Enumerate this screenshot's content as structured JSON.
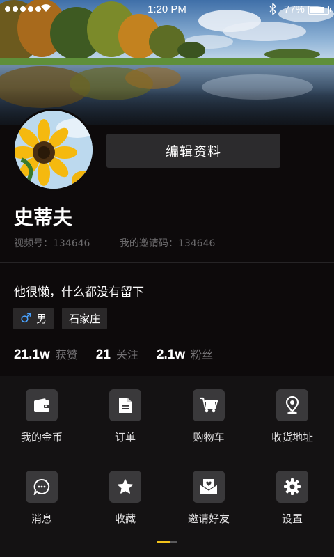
{
  "status_bar": {
    "time": "1:20 PM",
    "battery": "77%",
    "battery_level": 0.77
  },
  "profile": {
    "edit_label": "编辑资料",
    "name": "史蒂夫",
    "video_id": "视频号：134646",
    "invite_code": "我的邀请码：134646",
    "bio": "他很懒，什么都没有留下",
    "tags": [
      {
        "icon": "male-icon",
        "label": "男"
      },
      {
        "label": "石家庄"
      }
    ],
    "stats": [
      {
        "value": "21.1w",
        "label": "获赞"
      },
      {
        "value": "21",
        "label": "关注"
      },
      {
        "value": "2.1w",
        "label": "粉丝"
      }
    ]
  },
  "menu": {
    "items": [
      {
        "icon": "wallet-icon",
        "label": "我的金币"
      },
      {
        "icon": "document-icon",
        "label": "订单"
      },
      {
        "icon": "cart-icon",
        "label": "购物车"
      },
      {
        "icon": "location-pin-icon",
        "label": "收货地址"
      },
      {
        "icon": "chat-bubble-icon",
        "label": "消息"
      },
      {
        "icon": "star-icon",
        "label": "收藏"
      },
      {
        "icon": "invite-envelope-icon",
        "label": "邀请好友"
      },
      {
        "icon": "gear-icon",
        "label": "设置"
      }
    ],
    "page_indicator": {
      "pages": 2,
      "active": 0
    }
  },
  "colors": {
    "background": "#0d0a0b",
    "menu_background": "#141213",
    "icon_tile": "#3a393b",
    "accent": "#f2c21b",
    "male": "#4aa3ff"
  }
}
